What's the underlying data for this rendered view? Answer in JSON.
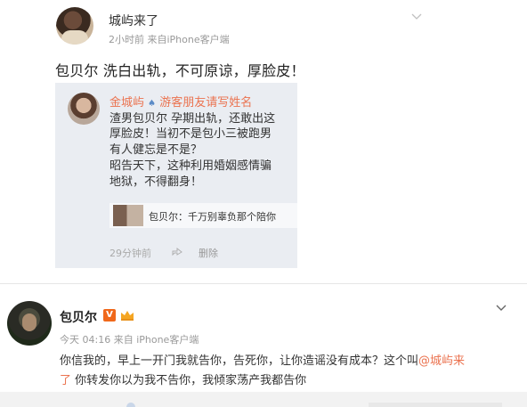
{
  "post1": {
    "username": "城屿来了",
    "meta": "2小时前  来自iPhone客户端",
    "text": "包贝尔 洗白出轨，不可原谅，厚脸皮！",
    "repost": {
      "author": "金城屿",
      "separator": "♠",
      "author_note": "游客朋友请写姓名",
      "lines": [
        "渣男包贝尔 孕期出轨，还敢出这",
        "厚脸皮！当初不是包小三被跑男",
        "有人健忘是不是？",
        "昭告天下，这种利用婚姻感情骗",
        "地狱，不得翻身！"
      ],
      "thumb_text": "包贝尔：千万别辜负那个陪你",
      "time": "29分钟前",
      "delete_label": "删除"
    }
  },
  "post2": {
    "username": "包贝尔",
    "verified_badge": "V",
    "meta": "今天 04:16 来自 iPhone客户端",
    "line1_before": "你信我的，早上一开门我就告你，告死你，让你造谣没有成本？这个叫",
    "mention_part1": "@城屿来",
    "mention_part2": "了",
    "line2_rest": " 你转发你以为我不告你，我倾家荡产我都告你"
  },
  "icons": {
    "menu_chevron": "chevron-down-icon",
    "share": "share-icon",
    "crown": "crown-icon"
  },
  "colors": {
    "link": "#eb7350",
    "verified": "#f0681b",
    "card_bg": "#eaedf2"
  }
}
